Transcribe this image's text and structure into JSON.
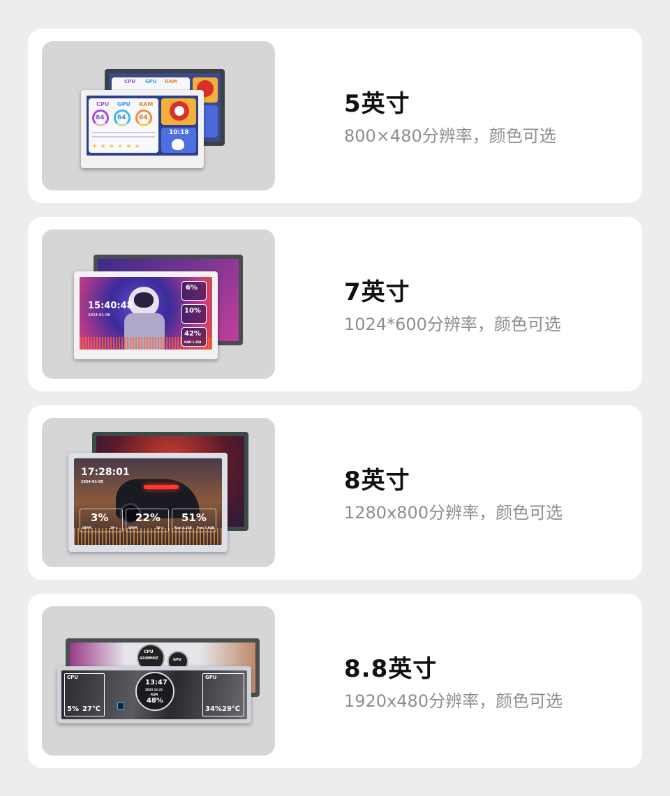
{
  "products": [
    {
      "size": "5英寸",
      "spec": "800×480分辨率，颜色可选",
      "screen": {
        "cpu": "CPU",
        "gpu": "GPU",
        "ram": "RAM",
        "cpu_val": "64",
        "gpu_val": "64",
        "ram_val": "64",
        "time": "10:18"
      }
    },
    {
      "size": "7英寸",
      "spec": "1024*600分辨率，颜色可选",
      "screen": {
        "time": "15:40:48",
        "date": "2024-01-06",
        "cpu_pct": "6%",
        "gpu_pct": "10%",
        "ram_pct": "42%",
        "ram_used": "RAM 1.35B"
      }
    },
    {
      "size": "8英寸",
      "spec": "1280x800分辨率，颜色可选",
      "screen": {
        "time": "17:28:01",
        "date": "2024-01-05",
        "cpu_pct": "3%",
        "gpu_pct": "22%",
        "ram_pct": "51%",
        "cpu_rpm": "0RPM",
        "cpu_temp": "39℃",
        "gpu_rpm": "0RPM",
        "gpu_temp": "50℃",
        "ram_used": "Ram 8.1GB",
        "ram_free": "Free 7.8GB"
      }
    },
    {
      "size": "8.8英寸",
      "spec": "1920x480分辨率，颜色可选",
      "screen": {
        "cpu_label": "CPU",
        "cpu_pct": "5%",
        "cpu_temp": "27℃",
        "clock": "13:47",
        "clock_date": "2023 12-21",
        "ram_label": "RAM",
        "ram_pct": "48%",
        "gpu_label": "GPU",
        "gpu_pct": "34%",
        "gpu_temp": "29℃",
        "back_cpu": "CPU",
        "back_freq": "4249MHZ",
        "back_gpu": "GPU"
      }
    }
  ],
  "colors": {
    "background": "#ededed",
    "card": "#ffffff",
    "image_bg": "#d6d6d6",
    "title": "#111111",
    "spec": "#8e8e8e"
  }
}
